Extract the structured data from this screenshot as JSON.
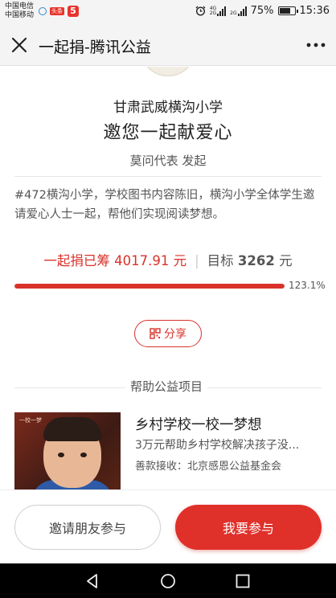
{
  "status_bar": {
    "carrier_1": "中国电信",
    "carrier_2": "中国移动",
    "app_badge": "头条",
    "app_badge_5": "5",
    "net_1": "4G",
    "net_2": "2G",
    "net_3": "2G",
    "battery": "75%",
    "battery_level": 0.75,
    "time": "15:36"
  },
  "navbar": {
    "title": "一起捐-腾讯公益",
    "close_icon": "close-icon",
    "more_icon": "more-icon"
  },
  "campaign": {
    "school": "甘肃武威横沟小学",
    "invite": "邀您一起献爱心",
    "initiator": "莫问代表 发起",
    "description": "#472横沟小学，学校图书内容陈旧，横沟小学全体学生邀请爱心人士一起，帮他们实现阅读梦想。",
    "raised_label": "一起捐已筹",
    "raised_amount": "4017.91",
    "raised_unit": "元",
    "goal_label": "目标",
    "goal_amount": "3262",
    "goal_unit": "元",
    "progress_percent_text": "123.1%",
    "progress_fraction": 1.0,
    "share_label": "分享",
    "share_icon": "qr-share-icon"
  },
  "section": {
    "title": "帮助公益项目"
  },
  "project": {
    "thumb_tag": "一校一梦",
    "title": "乡村学校一校一梦想",
    "subtitle": "3万元帮助乡村学校解决孩子没...",
    "org": "善款接收：北京感恩公益基金会"
  },
  "actions": {
    "invite_label": "邀请朋友参与",
    "join_label": "我要参与"
  },
  "colors": {
    "accent": "#e0302a",
    "text_secondary": "#555555"
  }
}
